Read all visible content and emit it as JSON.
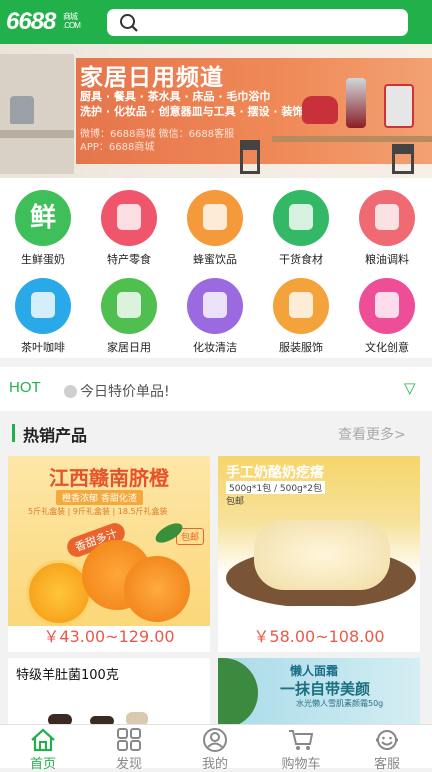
{
  "header": {
    "logo": "6688",
    "logo_sub": "商城 .COM",
    "search_placeholder": ""
  },
  "banner": {
    "title": "家居日用频道",
    "line1": "厨具 · 餐具 · 茶水具 · 床品 · 毛巾浴巾",
    "line2": "洗护 · 化妆品 · 创意器皿与工具 · 摆设 · 装饰",
    "contact1": "微博：6688商城   微信：6688客服",
    "contact2": "APP：6688商城",
    "dots_count": 7,
    "active_dot": 3
  },
  "categories": [
    {
      "label": "生鲜蛋奶",
      "color": "#3fbf5a",
      "icon": "fresh-icon",
      "glyph": "鲜"
    },
    {
      "label": "特产零食",
      "color": "#f0566b",
      "icon": "gift-icon",
      "glyph": ""
    },
    {
      "label": "蜂蜜饮品",
      "color": "#f49a3a",
      "icon": "honey-icon",
      "glyph": ""
    },
    {
      "label": "干货食材",
      "color": "#33b865",
      "icon": "mushroom-icon",
      "glyph": ""
    },
    {
      "label": "粮油调料",
      "color": "#f06a74",
      "icon": "oil-icon",
      "glyph": ""
    },
    {
      "label": "茶叶咖啡",
      "color": "#2aa9e8",
      "icon": "tea-cup-icon",
      "glyph": ""
    },
    {
      "label": "家居日用",
      "color": "#4fbf4f",
      "icon": "pot-icon",
      "glyph": ""
    },
    {
      "label": "化妆清洁",
      "color": "#9b6ae0",
      "icon": "cosmetics-icon",
      "glyph": ""
    },
    {
      "label": "服装服饰",
      "color": "#f3a33a",
      "icon": "dress-icon",
      "glyph": ""
    },
    {
      "label": "文化创意",
      "color": "#ee4d97",
      "icon": "creative-icon",
      "glyph": ""
    }
  ],
  "hot": {
    "tag": "HOT",
    "message": "今日特价单品!",
    "arrow": "▽"
  },
  "section": {
    "title": "热销产品",
    "more": "查看更多>"
  },
  "products": [
    {
      "name": "江西赣南脐橙",
      "sub": "橙香浓郁 香甜化渣",
      "tags": "5斤礼盒装 | 9斤礼盒装 | 18.5斤礼盒装",
      "badge": "香甜多汁",
      "shipping": "包邮",
      "price": "￥43.00~129.00"
    },
    {
      "name": "手工奶酪奶疙瘩",
      "sub": "500g*1包 / 500g*2包",
      "shipping": "包邮",
      "price": "￥58.00~108.00"
    },
    {
      "name": "特级羊肚菌100克"
    },
    {
      "name": "懒人面霜",
      "slogan": "一抹自带美颜",
      "sub": "水光懒人雪肌素颜霜50g"
    }
  ],
  "tabs": [
    {
      "label": "首页",
      "icon": "home-icon",
      "active": true
    },
    {
      "label": "发现",
      "icon": "discover-grid-icon",
      "active": false
    },
    {
      "label": "我的",
      "icon": "user-icon",
      "active": false
    },
    {
      "label": "购物车",
      "icon": "cart-icon",
      "active": false
    },
    {
      "label": "客服",
      "icon": "service-icon",
      "active": false
    }
  ]
}
